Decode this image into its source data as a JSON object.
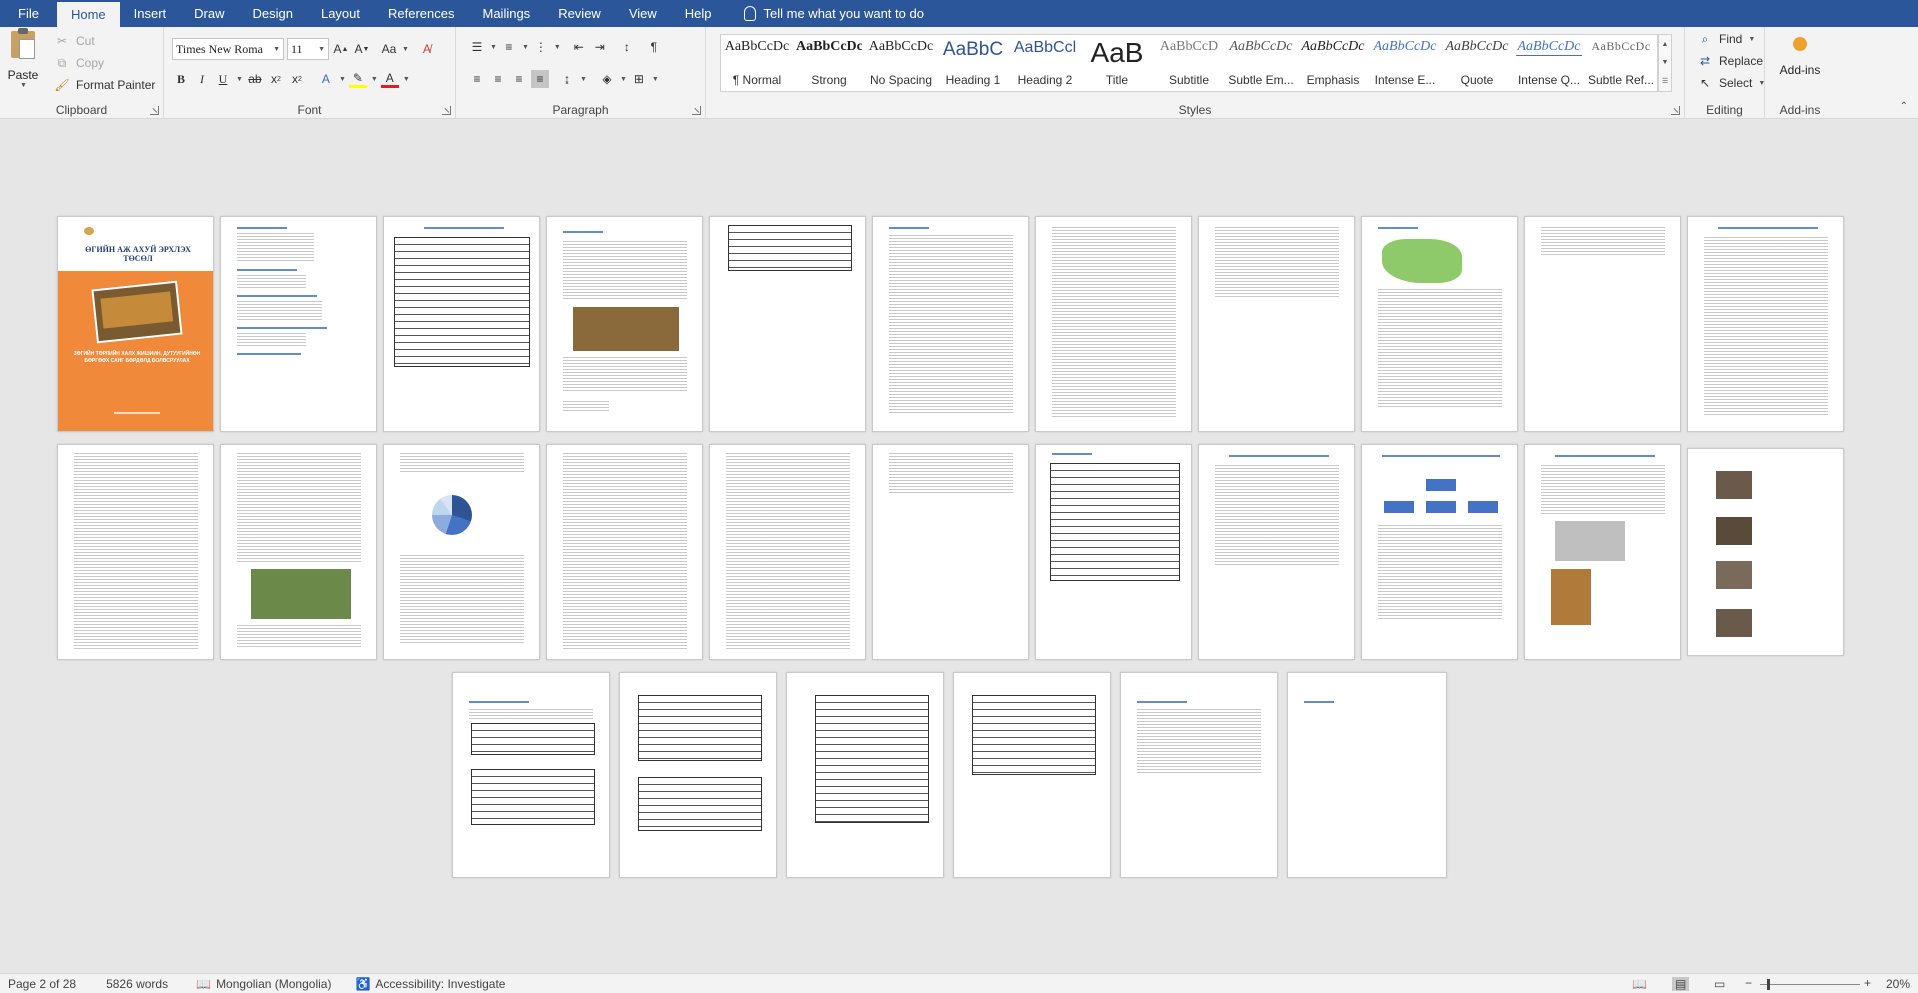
{
  "tabs": [
    "File",
    "Home",
    "Insert",
    "Draw",
    "Design",
    "Layout",
    "References",
    "Mailings",
    "Review",
    "View",
    "Help"
  ],
  "tell_me": "Tell me what you want to do",
  "clipboard": {
    "paste": "Paste",
    "cut": "Cut",
    "copy": "Copy",
    "format_painter": "Format Painter",
    "label": "Clipboard"
  },
  "font": {
    "family": "Times New Roma",
    "size": "11",
    "label": "Font"
  },
  "paragraph": {
    "label": "Paragraph"
  },
  "styles": {
    "label": "Styles",
    "items": [
      {
        "preview": "AaBbCcDc",
        "name": "¶ Normal"
      },
      {
        "preview": "AaBbCcDc",
        "name": "Strong"
      },
      {
        "preview": "AaBbCcDc",
        "name": "No Spacing"
      },
      {
        "preview": "AaBbC",
        "name": "Heading 1"
      },
      {
        "preview": "AaBbCcl",
        "name": "Heading 2"
      },
      {
        "preview": "AaB",
        "name": "Title"
      },
      {
        "preview": "AaBbCcD",
        "name": "Subtitle"
      },
      {
        "preview": "AaBbCcDc",
        "name": "Subtle Em..."
      },
      {
        "preview": "AaBbCcDc",
        "name": "Emphasis"
      },
      {
        "preview": "AaBbCcDc",
        "name": "Intense E..."
      },
      {
        "preview": "AaBbCcDc",
        "name": "Quote"
      },
      {
        "preview": "AaBbCcDc",
        "name": "Intense Q..."
      },
      {
        "preview": "AaBbCcDc",
        "name": "Subtle Ref..."
      }
    ]
  },
  "editing": {
    "find": "Find",
    "replace": "Replace",
    "select": "Select",
    "label": "Editing"
  },
  "addins": {
    "button": "Add-ins",
    "label": "Add-ins"
  },
  "cover_page": {
    "title_line1": "ӨГИЙН АЖ АХУЙ ЭРХЛЭХ",
    "title_line2": "ТӨСӨЛ",
    "subtitle": "ЗӨГИЙН ТӨРЛИЙН ХАЛХ ЖИШИИН, ДУТУУГИЙНӨН БӨРГӨӨХ САНГ БӨРДӨЛД БОЛВСРУУЛАХ",
    "accent": "#f0893a"
  },
  "pages_total": 28,
  "status": {
    "page": "Page 2 of 28",
    "words": "5826 words",
    "language": "Mongolian (Mongolia)",
    "accessibility": "Accessibility: Investigate",
    "zoom": "20%"
  }
}
